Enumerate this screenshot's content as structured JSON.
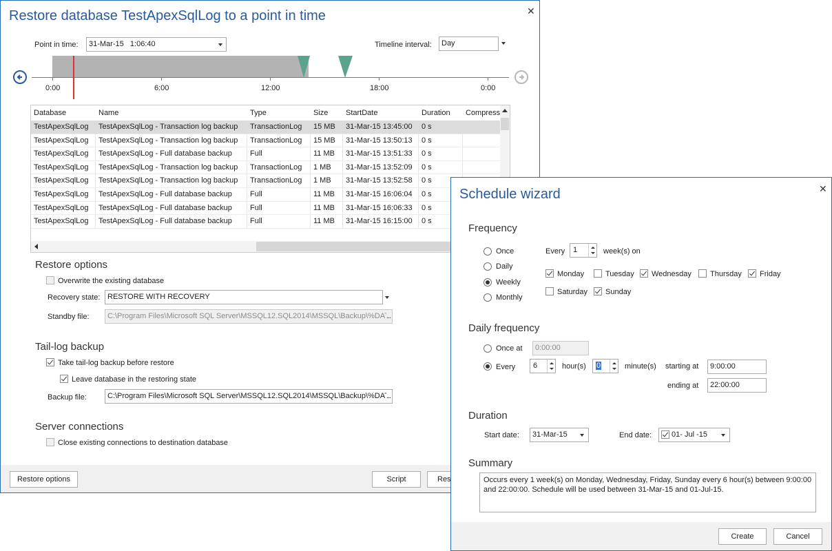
{
  "restore": {
    "title": "Restore database TestApexSqlLog to a point in time",
    "point_in_time_label": "Point in time:",
    "point_in_time_value": "31-Mar-15   1:06:40",
    "timeline_interval_label": "Timeline interval:",
    "timeline_interval_value": "Day",
    "timeline_ticks": [
      "0:00",
      "6:00",
      "12:00",
      "18:00",
      "0:00"
    ],
    "grid": {
      "columns": [
        "Database",
        "Name",
        "Type",
        "Size",
        "StartDate",
        "Duration",
        "Compress"
      ],
      "rows": [
        [
          "TestApexSqlLog",
          "TestApexSqlLog - Transaction log backup",
          "TransactionLog",
          "15 MB",
          "31-Mar-15 13:45:00",
          "0 s"
        ],
        [
          "TestApexSqlLog",
          "TestApexSqlLog - Transaction log backup",
          "TransactionLog",
          "15 MB",
          "31-Mar-15 13:50:13",
          "0 s"
        ],
        [
          "TestApexSqlLog",
          "TestApexSqlLog - Full database backup",
          "Full",
          "11 MB",
          "31-Mar-15 13:51:33",
          "0 s"
        ],
        [
          "TestApexSqlLog",
          "TestApexSqlLog - Transaction log backup",
          "TransactionLog",
          "1 MB",
          "31-Mar-15 13:52:09",
          "0 s"
        ],
        [
          "TestApexSqlLog",
          "TestApexSqlLog - Transaction log backup",
          "TransactionLog",
          "1 MB",
          "31-Mar-15 13:52:58",
          "0 s"
        ],
        [
          "TestApexSqlLog",
          "TestApexSqlLog - Full database backup",
          "Full",
          "11 MB",
          "31-Mar-15 16:06:04",
          "0 s"
        ],
        [
          "TestApexSqlLog",
          "TestApexSqlLog - Full database backup",
          "Full",
          "11 MB",
          "31-Mar-15 16:06:33",
          "0 s"
        ],
        [
          "TestApexSqlLog",
          "TestApexSqlLog - Full database backup",
          "Full",
          "11 MB",
          "31-Mar-15 16:15:00",
          "0 s"
        ]
      ]
    },
    "restore_options_heading": "Restore options",
    "overwrite_label": "Overwrite the existing database",
    "recovery_state_label": "Recovery state:",
    "recovery_state_value": "RESTORE WITH RECOVERY",
    "standby_file_label": "Standby file:",
    "standby_file_value": "C:\\Program Files\\Microsoft SQL Server\\MSSQL12.SQL2014\\MSSQL\\Backup\\%DAT",
    "tail_log_heading": "Tail-log backup",
    "take_tail_log_label": "Take tail-log backup before restore",
    "leave_restoring_label": "Leave database in the restoring state",
    "backup_file_label": "Backup file:",
    "backup_file_value": "C:\\Program Files\\Microsoft SQL Server\\MSSQL12.SQL2014\\MSSQL\\Backup\\%DAT",
    "server_connections_heading": "Server connections",
    "close_connections_label": "Close existing connections to destination database",
    "restore_options_button": "Restore options",
    "script_button": "Script",
    "restore_button": "Rest",
    "browse_label": "..."
  },
  "wizard": {
    "title": "Schedule wizard",
    "frequency_heading": "Frequency",
    "freq_options": [
      "Once",
      "Daily",
      "Weekly",
      "Monthly"
    ],
    "selected_freq": "Weekly",
    "every_label": "Every",
    "weeks_value": "1",
    "weeks_on_label": "week(s) on",
    "days": [
      {
        "name": "Monday",
        "checked": true
      },
      {
        "name": "Tuesday",
        "checked": false
      },
      {
        "name": "Wednesday",
        "checked": true
      },
      {
        "name": "Thursday",
        "checked": false
      },
      {
        "name": "Friday",
        "checked": true
      },
      {
        "name": "Saturday",
        "checked": false
      },
      {
        "name": "Sunday",
        "checked": true
      }
    ],
    "daily_frequency_heading": "Daily frequency",
    "once_at_label": "Once at",
    "once_at_value": "0:00:00",
    "every_daily_label": "Every",
    "hours_value": "6",
    "hours_label": "hour(s)",
    "minutes_value": "0",
    "minutes_label": "minute(s)",
    "starting_at_label": "starting at",
    "starting_at_value": "9:00:00",
    "ending_at_label": "ending at",
    "ending_at_value": "22:00:00",
    "duration_heading": "Duration",
    "start_date_label": "Start date:",
    "start_date_value": "31-Mar-15",
    "end_date_label": "End date:",
    "end_date_value": "01- Jul -15",
    "summary_heading": "Summary",
    "summary_text": "Occurs every 1 week(s) on Monday, Wednesday, Friday, Sunday every 6 hour(s) between 9:00:00 and 22:00:00. Schedule will be used between 31-Mar-15 and 01-Jul-15.",
    "create_button": "Create",
    "cancel_button": "Cancel"
  },
  "colors": {
    "title_blue": "#2a5a9b",
    "timeline_gray": "#b3b3b3",
    "marker_teal": "#5aa38e",
    "timeline_red": "#e03030"
  }
}
